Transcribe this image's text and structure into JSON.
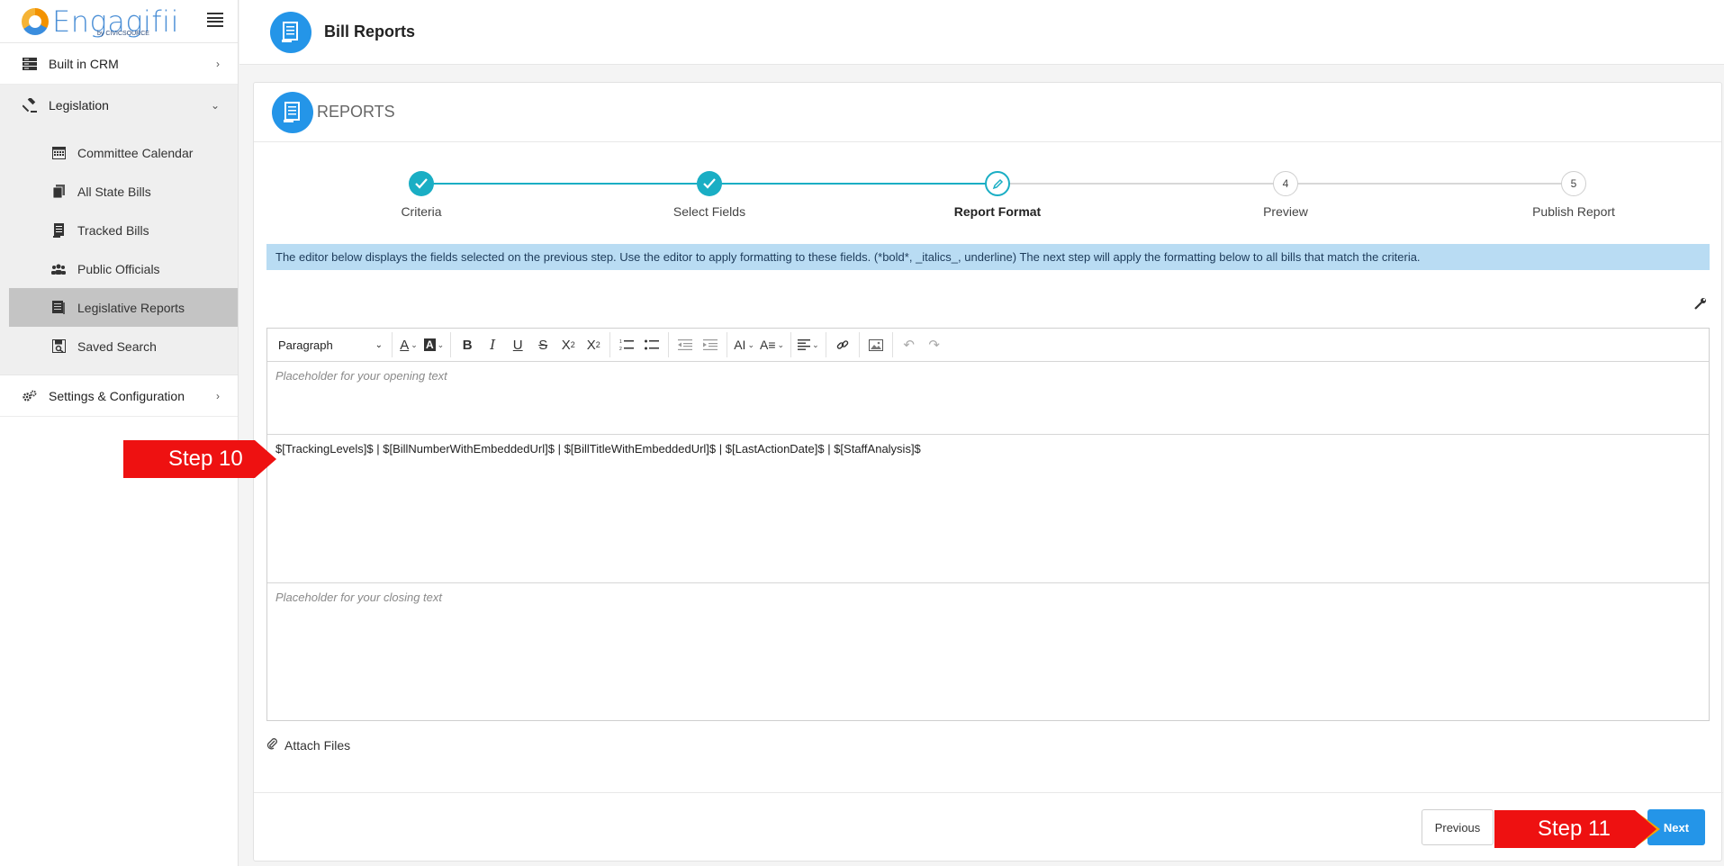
{
  "app": {
    "logo_text": "Engagifii",
    "logo_sub": "by CIVICSOURCE"
  },
  "sidebar": {
    "items": [
      {
        "label": "Built in CRM",
        "chevron": "›"
      },
      {
        "label": "Legislation",
        "chevron": "⌄"
      },
      {
        "label": "Settings & Configuration",
        "chevron": "›"
      }
    ],
    "sub_items": [
      {
        "label": "Committee Calendar"
      },
      {
        "label": "All State Bills"
      },
      {
        "label": "Tracked Bills"
      },
      {
        "label": "Public Officials"
      },
      {
        "label": "Legislative Reports"
      },
      {
        "label": "Saved Search"
      }
    ]
  },
  "header": {
    "title": "Bill Reports"
  },
  "card": {
    "title": "REPORTS"
  },
  "stepper": {
    "steps": [
      {
        "label": "Criteria",
        "state": "done"
      },
      {
        "label": "Select Fields",
        "state": "done"
      },
      {
        "label": "Report Format",
        "state": "active"
      },
      {
        "label": "Preview",
        "state": "pending",
        "number": "4"
      },
      {
        "label": "Publish Report",
        "state": "pending",
        "number": "5"
      }
    ]
  },
  "info_text": "The editor below displays the fields selected on the previous step. Use the editor to apply formatting to these fields. (*bold*, _italics_, underline) The next step will apply the formatting below to all bills that match the criteria.",
  "editor": {
    "paragraph_select": "Paragraph",
    "opening_placeholder": "Placeholder for your opening text",
    "body_text": "$[TrackingLevels]$ | $[BillNumberWithEmbeddedUrl]$ | $[BillTitleWithEmbeddedUrl]$ | $[LastActionDate]$ | $[StaffAnalysis]$",
    "closing_placeholder": "Placeholder for your closing text"
  },
  "attach_label": "Attach Files",
  "buttons": {
    "previous": "Previous",
    "next": "Next"
  },
  "callouts": {
    "step10": "Step 10",
    "step11": "Step 11"
  },
  "colors": {
    "accent": "#2495e8",
    "step_done": "#1aaec4",
    "info_bg": "#b9dcf3",
    "callout": "#ee1111"
  }
}
